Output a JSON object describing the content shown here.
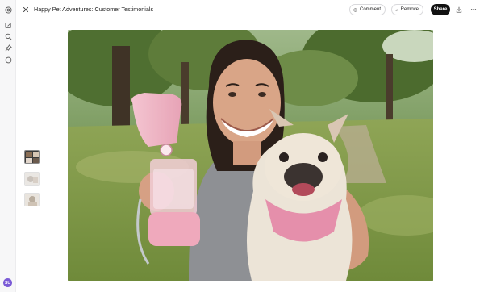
{
  "header": {
    "title": "Happy Pet Adventures: Customer Testimonials",
    "comment_label": "Comment",
    "remove_label": "Remove",
    "share_label": "Share"
  },
  "rail": {
    "icons": [
      "logo-icon",
      "edit-icon",
      "search-icon",
      "pin-icon",
      "chat-icon"
    ],
    "avatar_initials": "SU"
  },
  "thumbnails": [
    {
      "name": "thumbnail-1",
      "active": true
    },
    {
      "name": "thumbnail-2",
      "active": false
    },
    {
      "name": "thumbnail-3",
      "active": false
    }
  ],
  "image": {
    "alt": "Smiling woman in a park holding a pink pet water bottle next to a French bulldog wearing a pink bandana"
  },
  "colors": {
    "share_bg": "#111111",
    "avatar_bg": "#7b5bd6",
    "accent_pink": "#f2b8c6"
  }
}
